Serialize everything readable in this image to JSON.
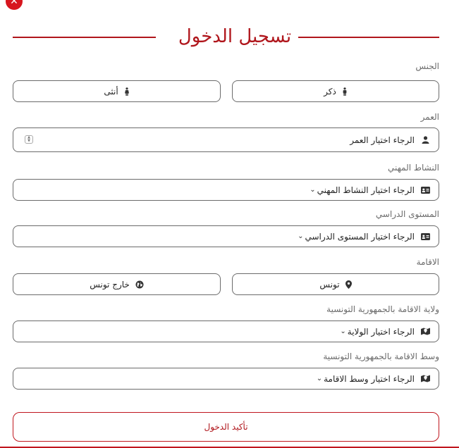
{
  "header": {
    "title": "تسجيل الدخول",
    "close_icon": "close-icon"
  },
  "gender": {
    "label": "الجنس",
    "options": [
      {
        "label": "ذكر",
        "icon": "male-icon"
      },
      {
        "label": "أنثى",
        "icon": "female-icon"
      }
    ]
  },
  "age": {
    "label": "العمر",
    "placeholder": "الرجاء اختيار العمر",
    "icon": "user-icon"
  },
  "profession": {
    "label": "النشاط المهني",
    "placeholder": "الرجاء اختيار النشاط المهني",
    "icon": "id-card-icon"
  },
  "education": {
    "label": "المستوى الدراسي",
    "placeholder": "الرجاء اختيار المستوى الدراسي",
    "icon": "id-card-icon"
  },
  "residence": {
    "label": "الاقامة",
    "options": [
      {
        "label": "تونس",
        "icon": "map-marker-icon"
      },
      {
        "label": "خارج تونس",
        "icon": "globe-icon"
      }
    ]
  },
  "governorate": {
    "label": "ولاية الاقامة بالجمهورية التونسية",
    "placeholder": "الرجاء اختيار الولاية",
    "icon": "map-icon"
  },
  "environment": {
    "label": "وسط الاقامة بالجمهورية التونسية",
    "placeholder": "الرجاء اختيار وسط الاقامة",
    "icon": "map-icon"
  },
  "submit": {
    "label": "تأكيد الدخول"
  },
  "colors": {
    "accent": "#b0161c",
    "border": "#6b6b6b"
  }
}
